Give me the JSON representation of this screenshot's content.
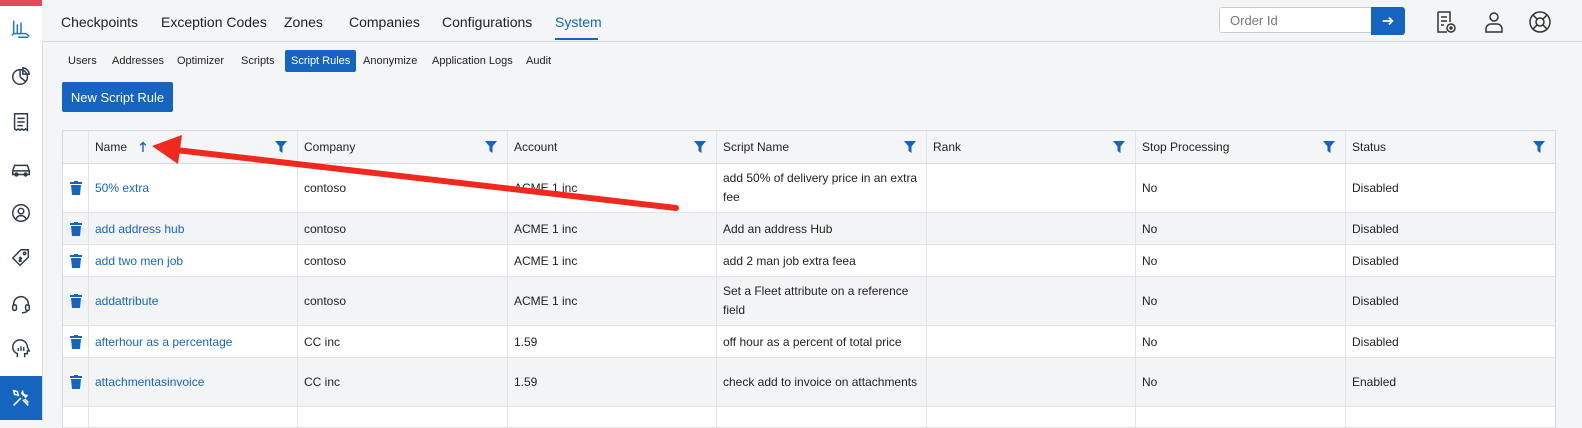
{
  "rail": {
    "icons": [
      "logo-icon",
      "pie-chart-icon",
      "receipt-icon",
      "car-icon",
      "user-circle-icon",
      "price-tag-icon",
      "headset-icon",
      "brain-icon",
      "tools-icon"
    ]
  },
  "topnav": {
    "tabs": [
      "Checkpoints",
      "Exception Codes",
      "Zones",
      "Companies",
      "Configurations",
      "System"
    ],
    "active": "System",
    "order_placeholder": "Order Id"
  },
  "subnav": {
    "items": [
      "Users",
      "Addresses",
      "Optimizer",
      "Scripts",
      "Script Rules",
      "Anonymize",
      "Application Logs",
      "Audit"
    ],
    "active": "Script Rules"
  },
  "new_button_label": "New Script Rule",
  "table": {
    "columns": [
      "Name",
      "Company",
      "Account",
      "Script Name",
      "Rank",
      "Stop Processing",
      "Status"
    ],
    "sort": {
      "column": "Name",
      "direction": "ascending"
    },
    "rows": [
      {
        "name": "50% extra",
        "company": "contoso",
        "account": "ACME 1 inc",
        "script_name": "add 50% of delivery price in an extra fee",
        "rank": "",
        "stop_processing": "No",
        "status": "Disabled"
      },
      {
        "name": "add address hub",
        "company": "contoso",
        "account": "ACME 1 inc",
        "script_name": "Add an address Hub",
        "rank": "",
        "stop_processing": "No",
        "status": "Disabled"
      },
      {
        "name": "add two men job",
        "company": "contoso",
        "account": "ACME 1 inc",
        "script_name": "add 2 man job extra feea",
        "rank": "",
        "stop_processing": "No",
        "status": "Disabled"
      },
      {
        "name": "addattribute",
        "company": "contoso",
        "account": "ACME 1 inc",
        "script_name": "Set a Fleet attribute on a reference field",
        "rank": "",
        "stop_processing": "No",
        "status": "Disabled"
      },
      {
        "name": "afterhour as a percentage",
        "company": "CC inc",
        "account": "1.59",
        "script_name": "off hour as a percent of total price",
        "rank": "",
        "stop_processing": "No",
        "status": "Disabled"
      },
      {
        "name": "attachmentasinvoice",
        "company": "CC inc",
        "account": "1.59",
        "script_name": "check add to invoice on attachments",
        "rank": "",
        "stop_processing": "No",
        "status": "Enabled"
      }
    ]
  },
  "annotation": {
    "type": "red-arrow",
    "points_to": "Name column sort indicator",
    "color": "#f0281e"
  },
  "colors": {
    "accent": "#1565c0",
    "rail_top": "#e24a5a",
    "arrow": "#f0281e"
  }
}
